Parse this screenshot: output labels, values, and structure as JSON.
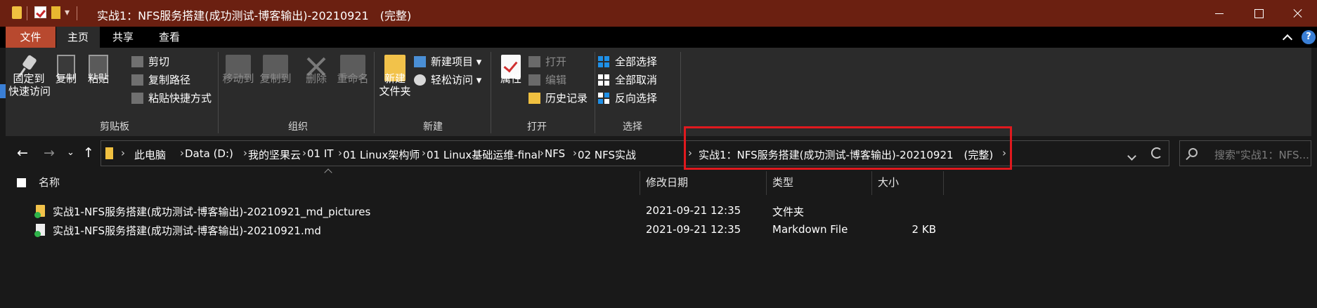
{
  "window": {
    "title": "实战1：NFS服务搭建(成功测试-博客输出)-20210921　(完整)",
    "minimize": "minimize",
    "maximize": "maximize",
    "close": "close"
  },
  "tabs": {
    "file": "文件",
    "home": "主页",
    "share": "共享",
    "view": "查看"
  },
  "ribbon": {
    "clipboard": {
      "label": "剪贴板",
      "pin_line1": "固定到",
      "pin_line2": "快速访问",
      "copy": "复制",
      "paste": "粘贴",
      "cut": "剪切",
      "copy_path": "复制路径",
      "paste_shortcut": "粘贴快捷方式"
    },
    "organize": {
      "label": "组织",
      "move_to": "移动到",
      "copy_to": "复制到",
      "delete": "删除",
      "rename": "重命名"
    },
    "new": {
      "label": "新建",
      "new_folder_line1": "新建",
      "new_folder_line2": "文件夹",
      "new_item": "新建项目",
      "easy_access": "轻松访问"
    },
    "open": {
      "label": "打开",
      "properties": "属性",
      "open": "打开",
      "edit": "编辑",
      "history": "历史记录"
    },
    "select": {
      "label": "选择",
      "select_all": "全部选择",
      "select_none": "全部取消",
      "invert": "反向选择"
    }
  },
  "address": {
    "crumbs": [
      "此电脑",
      "Data (D:)",
      "我的坚果云",
      "01 IT",
      "01 Linux架构师",
      "01 Linux基础运维-final",
      "NFS",
      "02 NFS实战",
      "实战1：NFS服务搭建(成功测试-博客输出)-20210921　(完整)"
    ],
    "search_placeholder": "搜索\"实战1：NFS..."
  },
  "columns": {
    "name": "名称",
    "modified": "修改日期",
    "type": "类型",
    "size": "大小"
  },
  "files": [
    {
      "name": "实战1-NFS服务搭建(成功测试-博客输出)-20210921_md_pictures",
      "modified": "2021-09-21 12:35",
      "type": "文件夹",
      "size": "",
      "icon": "folder-icon"
    },
    {
      "name": "实战1-NFS服务搭建(成功测试-博客输出)-20210921.md",
      "modified": "2021-09-21 12:35",
      "type": "Markdown File",
      "size": "2 KB",
      "icon": "markdown-file-icon"
    }
  ],
  "colors": {
    "titlebar": "#6b2011",
    "file_tab": "#b8492f",
    "highlight": "#e0191e",
    "background": "#191919"
  }
}
